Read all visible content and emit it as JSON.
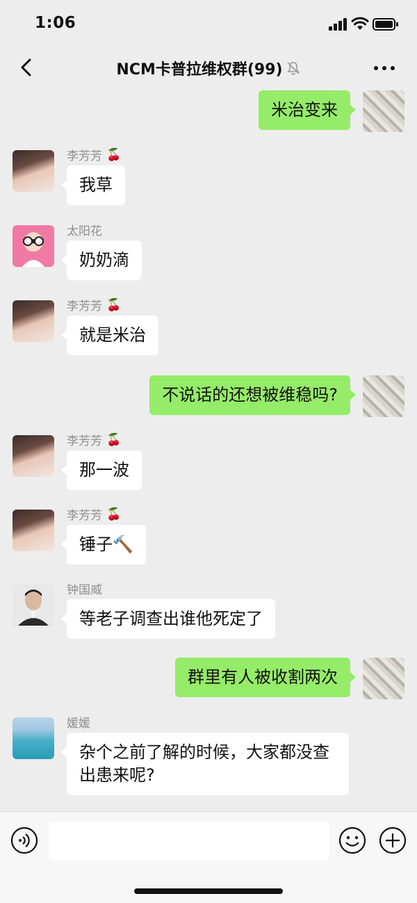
{
  "status_bar": {
    "time": "1:06"
  },
  "nav": {
    "title": "NCM卡普拉维权群(99)",
    "icons": [
      "back-icon",
      "mute-icon",
      "more-icon"
    ]
  },
  "messages": [
    {
      "side": "out",
      "text": "米治变来",
      "avatar": "self"
    },
    {
      "side": "in",
      "sender": "李芳芳",
      "emoji": "🍒",
      "text": "我草",
      "avatar": "girl"
    },
    {
      "side": "in",
      "sender": "太阳花",
      "text": "奶奶滴",
      "avatar": "sunflower"
    },
    {
      "side": "in",
      "sender": "李芳芳",
      "emoji": "🍒",
      "text": "就是米治",
      "avatar": "girl"
    },
    {
      "side": "out",
      "text": "不说话的还想被维稳吗?",
      "avatar": "self"
    },
    {
      "side": "in",
      "sender": "李芳芳",
      "emoji": "🍒",
      "text": "那一波",
      "avatar": "girl"
    },
    {
      "side": "in",
      "sender": "李芳芳",
      "emoji": "🍒",
      "text": "锤子🔨",
      "avatar": "girl"
    },
    {
      "side": "in",
      "sender": "钟国威",
      "text": "等老子调查出谁他死定了",
      "avatar": "man"
    },
    {
      "side": "out",
      "text": "群里有人被收割两次",
      "avatar": "self"
    },
    {
      "side": "in",
      "sender": "媛媛",
      "text": "杂个之前了解的时候，大家都没查出患来呢?",
      "avatar": "sea"
    }
  ],
  "input_bar": {
    "icons": [
      "voice-icon",
      "emoji-icon",
      "plus-icon"
    ]
  },
  "colors": {
    "background": "#ededed",
    "out_bubble": "#95ec69",
    "in_bubble": "#ffffff"
  }
}
